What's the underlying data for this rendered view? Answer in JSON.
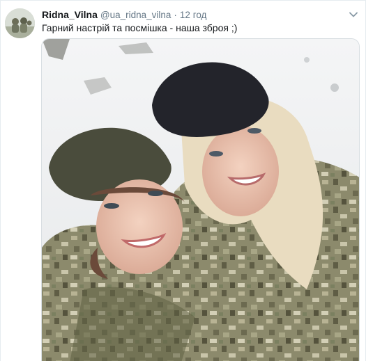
{
  "tweet": {
    "author": {
      "display_name": "Ridna_Vilna",
      "handle": "@ua_ridna_vilna",
      "avatar_icon": "avatar-photo"
    },
    "separator": "·",
    "time": "12 год",
    "text": "Гарний настрій та посмішка - наша зброя ;)",
    "menu_icon": "chevron-down-icon",
    "media": {
      "kind": "photo",
      "subject_icon": "photo-two-smiling-women-in-camouflage"
    }
  },
  "colors": {
    "text_primary": "#14171a",
    "text_secondary": "#657786",
    "border": "#e6ecf0"
  }
}
